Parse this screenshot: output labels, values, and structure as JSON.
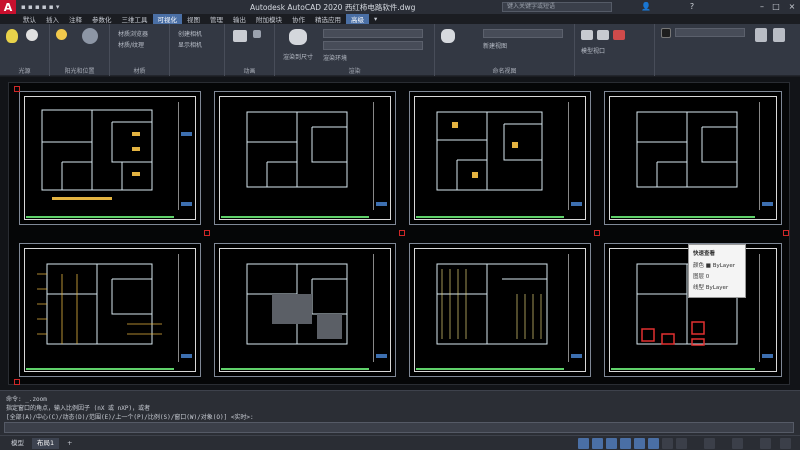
{
  "app": {
    "logo": "A",
    "title": "Autodesk AutoCAD 2020   西红柿电路软件.dwg",
    "search_placeholder": "键入关键字或短语"
  },
  "menu": [
    "默认",
    "插入",
    "注释",
    "参数化",
    "三维工具",
    "可视化",
    "视图",
    "管理",
    "输出",
    "附加模块",
    "协作",
    "精选应用",
    "高级",
    "▾"
  ],
  "ribbon": {
    "panels": [
      "光源",
      "阳光和位置",
      "材质",
      "",
      "动画",
      "",
      "渲染",
      "",
      "命名视图",
      "",
      ""
    ],
    "labels": {
      "r1": "材质浏览器",
      "r2": "材质/纹理",
      "r3": "创建相机",
      "r4": "显示相机",
      "r5": "渲染到尺寸",
      "r6": "渲染环境",
      "r7": "新建视图",
      "r8": "模型视口"
    }
  },
  "popup": {
    "title": "快速查看",
    "rows": [
      "颜色  ■ ByLayer",
      "图层  0",
      "线型  ByLayer"
    ]
  },
  "command": {
    "line1": "命令: _.zoom",
    "line2": "指定窗口的角点，输入比例因子 (nX 或 nXP)，或者",
    "line3": "[全部(A)/中心(C)/动态(D)/范围(E)/上一个(P)/比例(S)/窗口(W)/对象(O)] <实时>:"
  },
  "status": {
    "tabs": [
      "模型",
      "布局1"
    ],
    "active_tab": 1
  },
  "colors": {
    "accent": "#4a6fa5",
    "logo": "#c8102e",
    "drawing_line": "#d8e8f0",
    "highlight": "#d02828",
    "green": "#5fd16a"
  }
}
